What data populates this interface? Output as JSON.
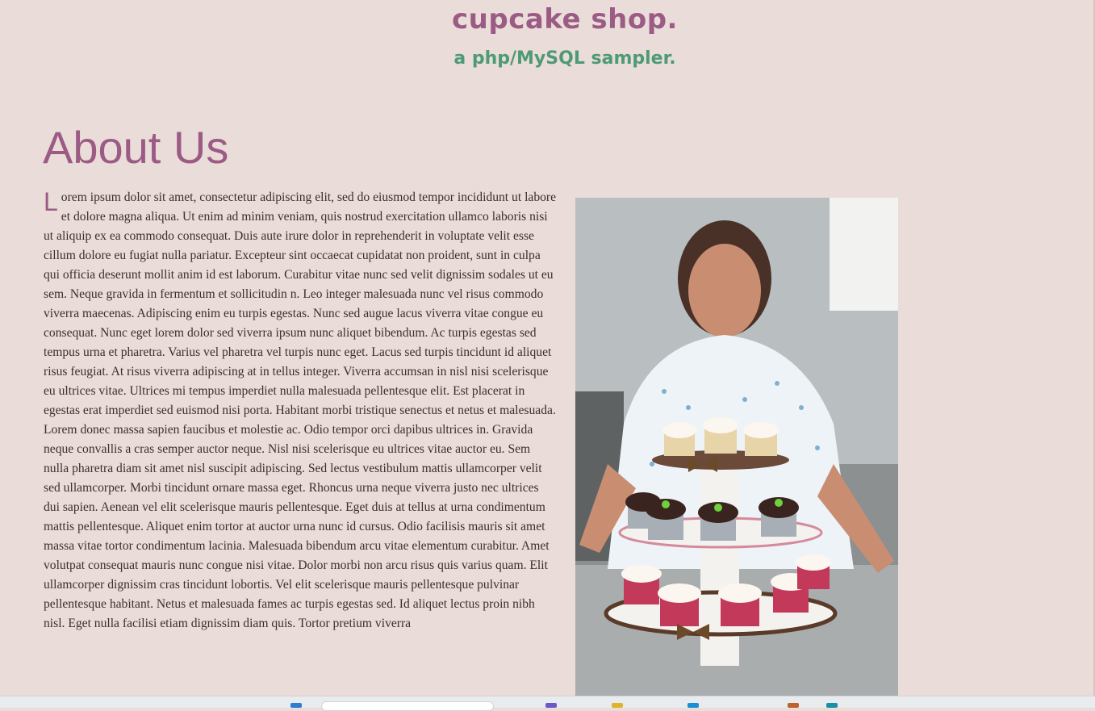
{
  "header": {
    "title": "cupcake shop.",
    "subtitle": "a php/MySQL sampler."
  },
  "main": {
    "heading": "About Us",
    "drop_cap": "L",
    "body": "orem ipsum dolor sit amet, consectetur adipiscing elit, sed do eiusmod tempor incididunt ut labore et dolore magna aliqua. Ut enim ad minim veniam, quis nostrud exercitation ullamco laboris nisi ut aliquip ex ea commodo consequat. Duis aute irure dolor in reprehenderit in voluptate velit esse cillum dolore eu fugiat nulla pariatur. Excepteur sint occaecat cupidatat non proident, sunt in culpa qui officia deserunt mollit anim id est laborum. Curabitur vitae nunc sed velit dignissim sodales ut eu sem. Neque gravida in fermentum et sollicitudin n. Leo integer malesuada nunc vel risus commodo viverra maecenas. Adipiscing enim eu turpis egestas. Nunc sed augue lacus viverra vitae congue eu consequat. Nunc eget lorem dolor sed viverra ipsum nunc aliquet bibendum. Ac turpis egestas sed tempus urna et pharetra. Varius vel pharetra vel turpis nunc eget. Lacus sed turpis tincidunt id aliquet risus feugiat. At risus viverra adipiscing at in tellus integer. Viverra accumsan in nisl nisi scelerisque eu ultrices vitae. Ultrices mi tempus imperdiet nulla malesuada pellentesque elit. Est placerat in egestas erat imperdiet sed euismod nisi porta. Habitant morbi tristique senectus et netus et malesuada. Lorem donec massa sapien faucibus et molestie ac. Odio tempor orci dapibus ultrices in. Gravida neque convallis a cras semper auctor neque. Nisl nisi scelerisque eu ultrices vitae auctor eu. Sem nulla pharetra diam sit amet nisl suscipit adipiscing. Sed lectus vestibulum mattis ullamcorper velit sed ullamcorper. Morbi tincidunt ornare massa eget. Rhoncus urna neque viverra justo nec ultrices dui sapien. Aenean vel elit scelerisque mauris pellentesque. Eget duis at tellus at urna condimentum mattis pellentesque. Aliquet enim tortor at auctor urna nunc id cursus. Odio facilisis mauris sit amet massa vitae tortor condimentum lacinia. Malesuada bibendum arcu vitae elementum curabitur. Amet volutpat consequat mauris nunc congue nisi vitae. Dolor morbi non arcu risus quis varius quam. Elit ullamcorper dignissim cras tincidunt lobortis. Vel elit scelerisque mauris pellentesque pulvinar pellentesque habitant. Netus et malesuada fames ac turpis egestas sed. Id aliquet lectus proin nibh nisl. Eget nulla facilisi etiam dignissim diam quis. Tortor pretium viverra"
  },
  "photo": {
    "icon": "cupcake-photo"
  },
  "colors": {
    "background": "#eadcd8",
    "title": "#9b5b85",
    "subtitle": "#4f9a76",
    "text": "#3b2f2e"
  }
}
